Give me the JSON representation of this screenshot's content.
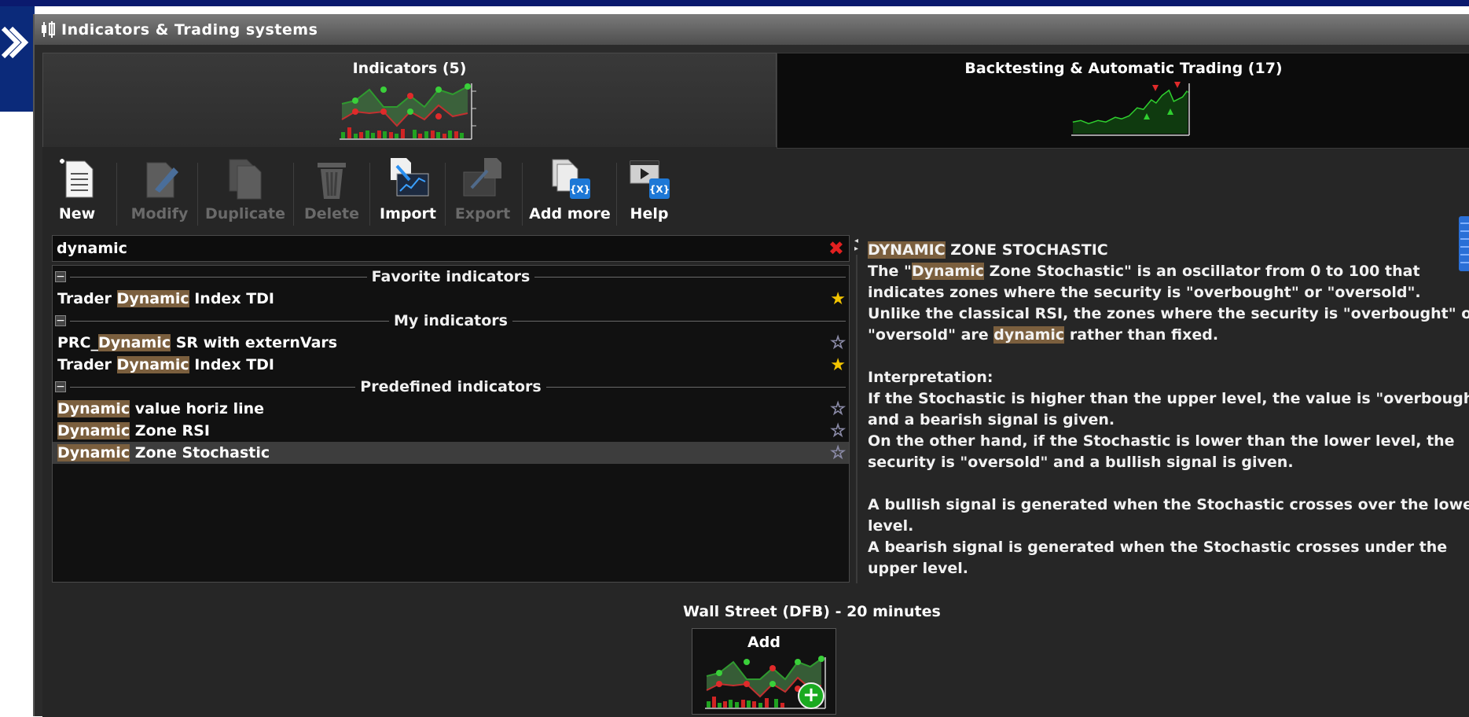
{
  "window": {
    "title": "Indicators & Trading systems"
  },
  "tabs": [
    {
      "label": "Indicators (5)"
    },
    {
      "label": "Backtesting & Automatic Trading (17)"
    }
  ],
  "toolbar": {
    "new": "New",
    "modify": "Modify",
    "duplicate": "Duplicate",
    "delete": "Delete",
    "import": "Import",
    "export": "Export",
    "add_more": "Add more",
    "help": "Help"
  },
  "search": {
    "value": "dynamic",
    "clear": "✖"
  },
  "groups": {
    "favorite": "Favorite indicators",
    "my": "My indicators",
    "predefined": "Predefined indicators"
  },
  "items": {
    "fav1": {
      "pre": "Trader ",
      "hl": "Dynamic",
      "post": " Index TDI",
      "starred": true
    },
    "my1": {
      "pre": "PRC_",
      "hl": "Dynamic",
      "post": " SR with externVars",
      "starred": false
    },
    "my2": {
      "pre": "Trader ",
      "hl": "Dynamic",
      "post": " Index TDI",
      "starred": true
    },
    "pre1": {
      "pre": "",
      "hl": "Dynamic",
      "post": " value horiz line",
      "starred": false
    },
    "pre2": {
      "pre": "",
      "hl": "Dynamic",
      "post": " Zone RSI",
      "starred": false
    },
    "pre3": {
      "pre": "",
      "hl": "Dynamic",
      "post": " Zone Stochastic",
      "starred": false
    }
  },
  "stars": {
    "on": "★",
    "off": "☆"
  },
  "description": {
    "title_hl": "DYNAMIC",
    "title_rest": " ZONE STOCHASTIC",
    "l1_pre": "The \"",
    "l1_hl": "Dynamic",
    "l1_post": " Zone Stochastic\" is an oscillator from 0 to 100 that",
    "l2": "indicates zones where the security is \"overbought\" or \"oversold\".",
    "l3": "Unlike the classical RSI, the zones where the security is \"overbought\" or",
    "l4_pre": "\"oversold\" are ",
    "l4_hl": "dynamic",
    "l4_post": " rather than fixed.",
    "l5": "Interpretation:",
    "l6": "If the Stochastic is higher than the upper level, the value is \"overbought\"",
    "l7": "and a bearish signal is given.",
    "l8": "On the other hand, if the Stochastic is lower than the lower level, the",
    "l9": "security is \"oversold\" and a bullish signal is given.",
    "l10": "A bullish signal is generated when the Stochastic crosses over the lower",
    "l11": "level.",
    "l12": "A bearish signal is generated when the Stochastic crosses under the",
    "l13": "upper level."
  },
  "symbol": "Wall Street (DFB) - 20 minutes",
  "add_button": {
    "label": "Add",
    "plus": "+"
  },
  "colors": {
    "highlight": "#7b5f3e",
    "star": "#f2c400",
    "clear": "#e22020",
    "add": "#1aaa20"
  }
}
